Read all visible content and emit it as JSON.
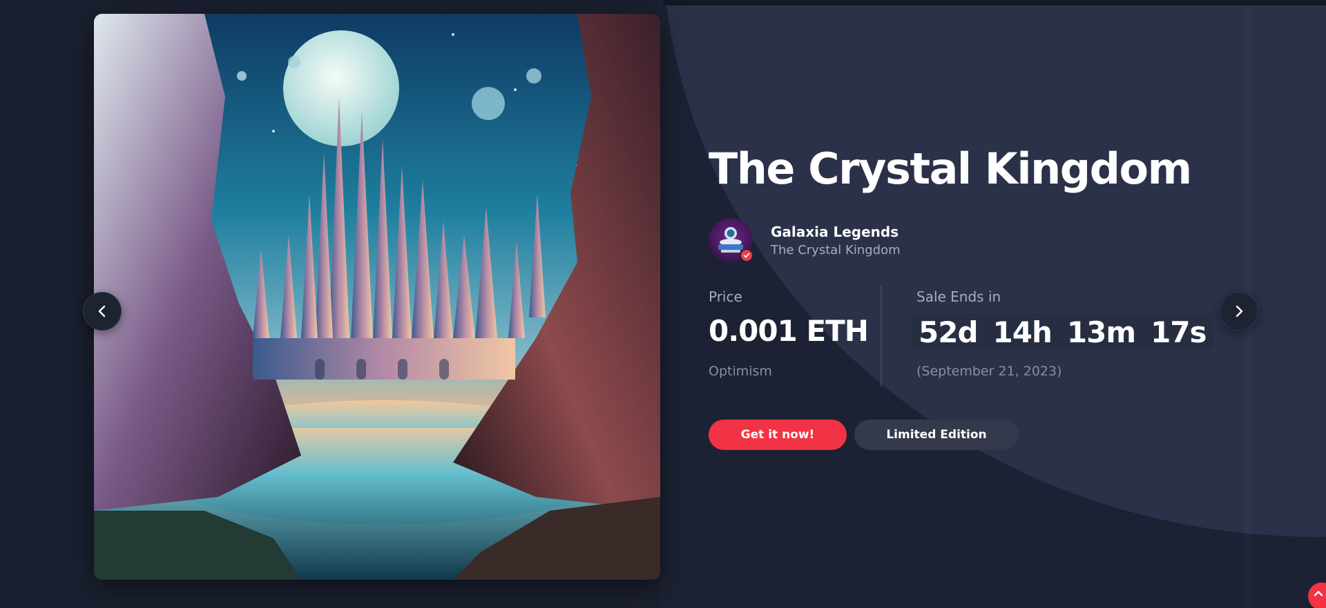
{
  "artwork": {
    "alt_subject": "castle-landscape-artwork"
  },
  "nft": {
    "title": "The Crystal Kingdom",
    "creator": "Galaxia Legends",
    "collection": "The Crystal Kingdom"
  },
  "price": {
    "label": "Price",
    "value": "0.001 ETH",
    "network": "Optimism"
  },
  "sale": {
    "label": "Sale Ends in",
    "days": "52d",
    "hours": "14h",
    "minutes": "13m",
    "seconds": "17s",
    "end_date": "(September 21, 2023)"
  },
  "actions": {
    "primary_label": "Get it now!",
    "secondary_label": "Limited Edition"
  },
  "icons": {
    "prev": "chevron-left-icon",
    "next": "chevron-right-icon",
    "verified": "check-icon",
    "scroll_top": "chevron-up-icon"
  },
  "colors": {
    "accent": "#f23345",
    "background": "#1b2030",
    "panel": "#2b3148"
  }
}
